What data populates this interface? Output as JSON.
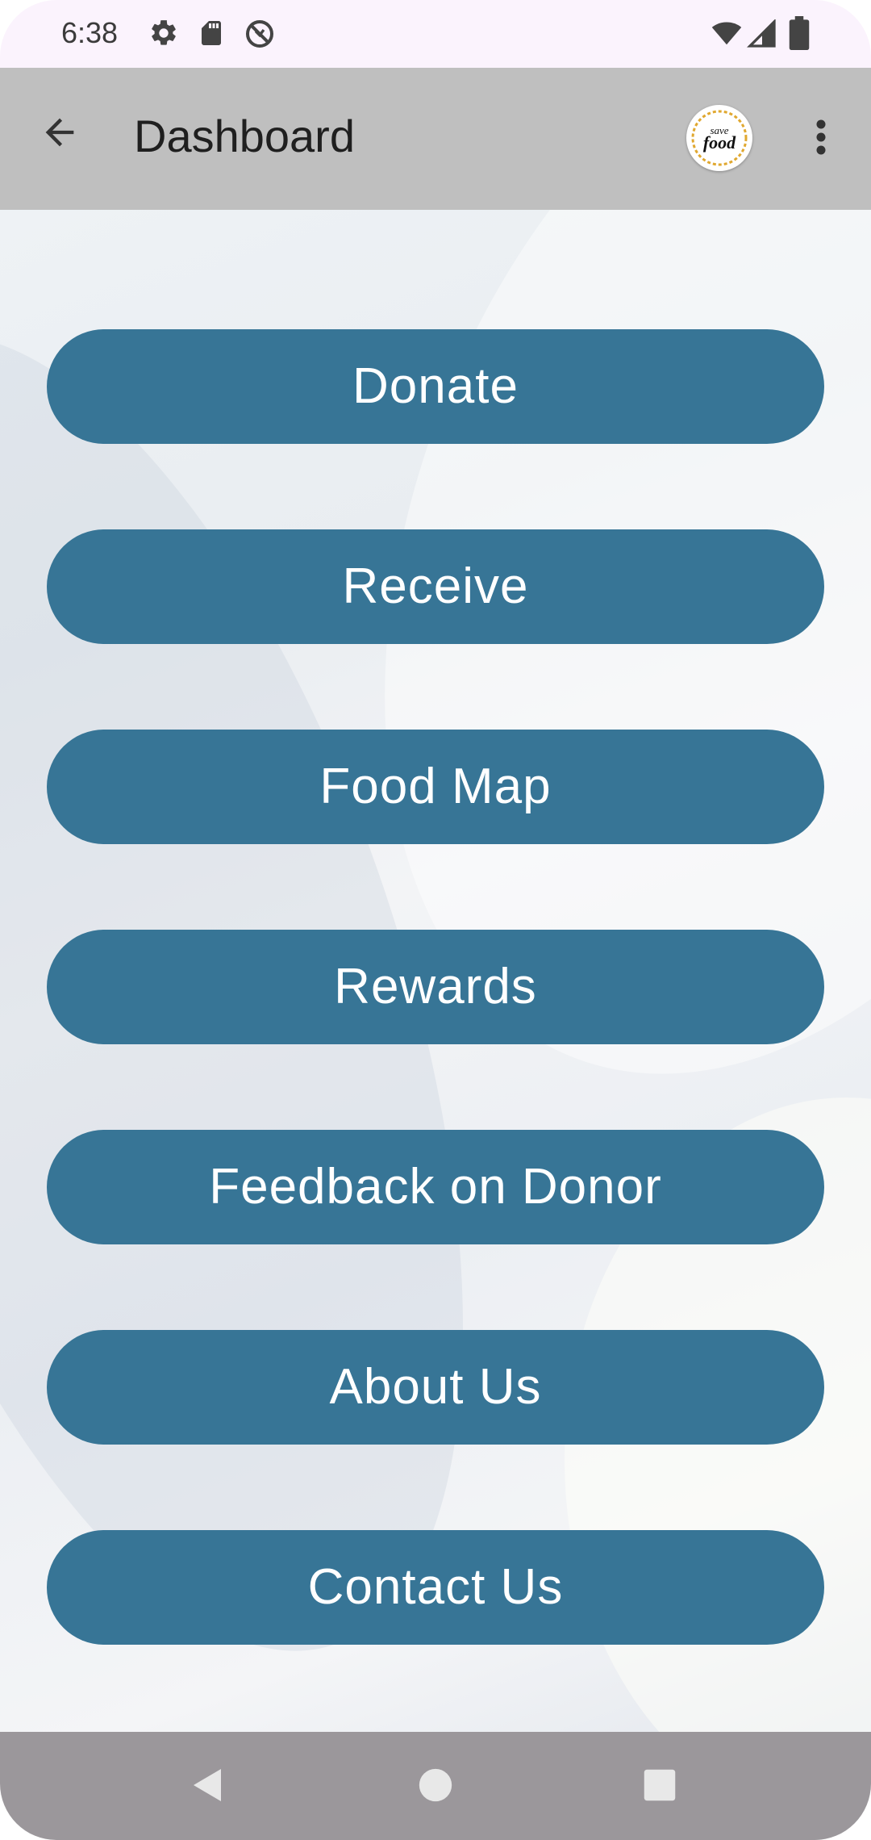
{
  "status_bar": {
    "time": "6:38",
    "left_icons": [
      "gear-icon",
      "sd-card-icon",
      "no-sync-icon"
    ],
    "right_icons": [
      "wifi-icon",
      "cell-signal-icon",
      "battery-icon"
    ]
  },
  "app_bar": {
    "title": "Dashboard",
    "back_icon": "arrow-back-icon",
    "logo_text_top": "save",
    "logo_text_bottom": "food",
    "menu_icon": "more-vert-icon"
  },
  "menu": {
    "buttons": [
      {
        "label": "Donate"
      },
      {
        "label": "Receive"
      },
      {
        "label": "Food Map"
      },
      {
        "label": "Rewards"
      },
      {
        "label": "Feedback on Donor"
      },
      {
        "label": "About Us"
      },
      {
        "label": "Contact Us"
      }
    ]
  },
  "nav_bar": {
    "back_icon": "nav-back-icon",
    "home_icon": "nav-home-icon",
    "recents_icon": "nav-recents-icon"
  },
  "colors": {
    "button": "#377596",
    "app_bar": "#bfbfbf",
    "status_bar": "#fbf3fd",
    "nav_bar": "#9b979b"
  }
}
